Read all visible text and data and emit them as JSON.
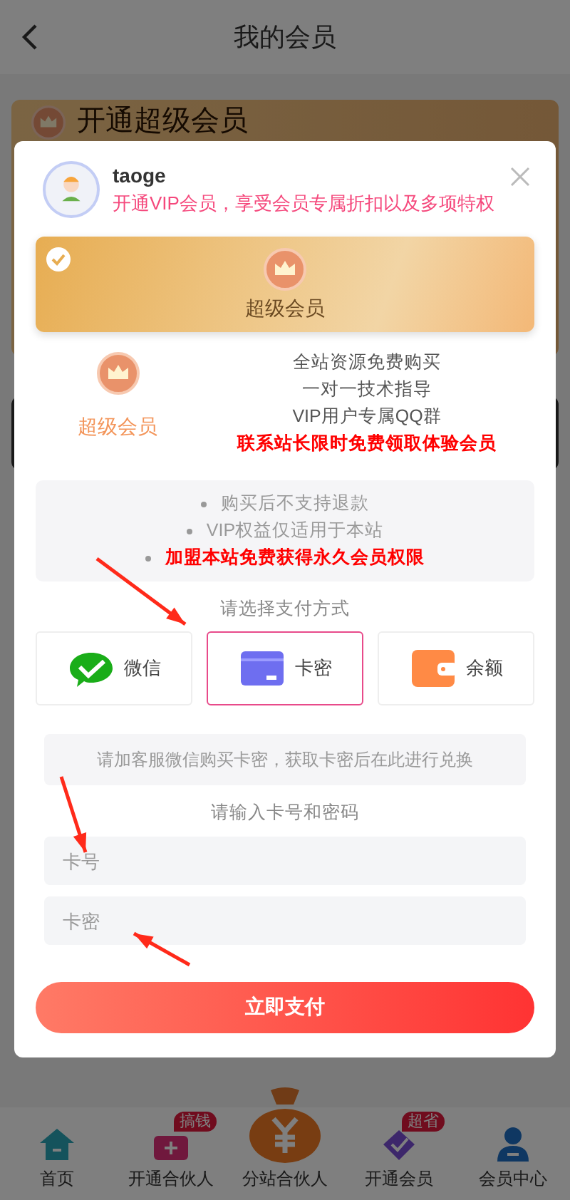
{
  "page": {
    "title": "我的会员",
    "card_title": "开通超级会员"
  },
  "dialog": {
    "user": {
      "name": "taoge",
      "tagline": "开通VIP会员，享受会员专属折扣以及多项特权"
    },
    "plans": [
      {
        "label": "超级会员",
        "selected": true
      }
    ],
    "benefits": {
      "plan_label": "超级会员",
      "lines": [
        {
          "text": "全站资源免费购买",
          "highlight": false
        },
        {
          "text": "一对一技术指导",
          "highlight": false
        },
        {
          "text": "VIP用户专属QQ群",
          "highlight": false
        },
        {
          "text": "联系站长限时免费领取体验会员",
          "highlight": true
        }
      ]
    },
    "notices": [
      {
        "text": "购买后不支持退款",
        "highlight": false
      },
      {
        "text": "VIP权益仅适用于本站",
        "highlight": false
      },
      {
        "text": "加盟本站免费获得永久会员权限",
        "highlight": true
      }
    ],
    "payment_prompt": "请选择支付方式",
    "payment_methods": [
      {
        "kind": "wechat",
        "label": "微信",
        "selected": false
      },
      {
        "kind": "card",
        "label": "卡密",
        "selected": true
      },
      {
        "kind": "balance",
        "label": "余额",
        "selected": false
      }
    ],
    "hint": "请加客服微信购买卡密，获取卡密后在此进行兑换",
    "input_prompt": "请输入卡号和密码",
    "fields": [
      {
        "placeholder": "卡号"
      },
      {
        "placeholder": "卡密"
      }
    ],
    "submit": "立即支付"
  },
  "tab_bar": [
    {
      "kind": "home",
      "label": "首页"
    },
    {
      "kind": "partner",
      "label": "开通合伙人",
      "badge": "搞钱"
    },
    {
      "kind": "moneybag",
      "label": "分站合伙人"
    },
    {
      "kind": "vip",
      "label": "开通会员",
      "badge": "超省"
    },
    {
      "kind": "user",
      "label": "会员中心"
    }
  ]
}
